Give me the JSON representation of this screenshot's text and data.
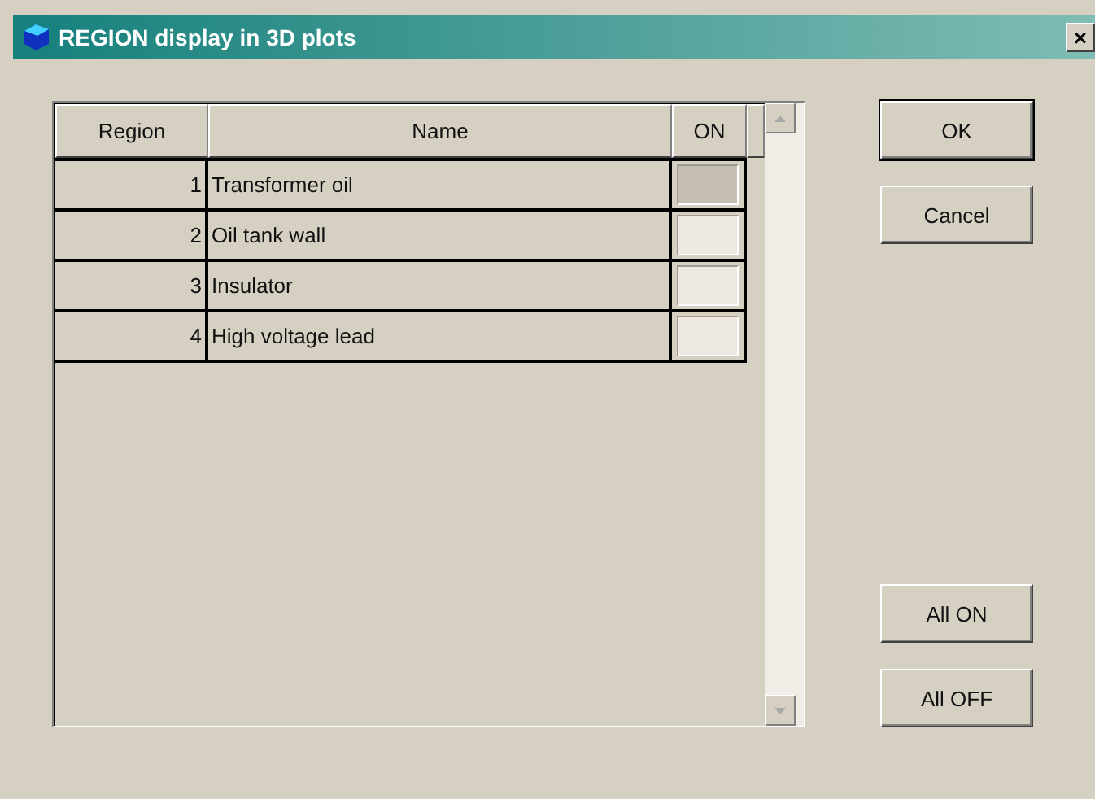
{
  "window": {
    "title": "REGION display in 3D plots",
    "close": "×"
  },
  "table": {
    "columns": [
      "Region",
      "Name",
      "ON"
    ],
    "rows": [
      {
        "region": "1",
        "name": "Transformer oil",
        "on": false,
        "selected": true
      },
      {
        "region": "2",
        "name": "Oil tank wall",
        "on": false,
        "selected": false
      },
      {
        "region": "3",
        "name": "Insulator",
        "on": false,
        "selected": false
      },
      {
        "region": "4",
        "name": "High voltage lead",
        "on": false,
        "selected": false
      }
    ]
  },
  "buttons": [
    {
      "label": "OK",
      "default": true
    },
    {
      "label": "Cancel",
      "default": false
    }
  ],
  "bottom_buttons": [
    {
      "label": "All ON"
    },
    {
      "label": "All OFF"
    }
  ]
}
